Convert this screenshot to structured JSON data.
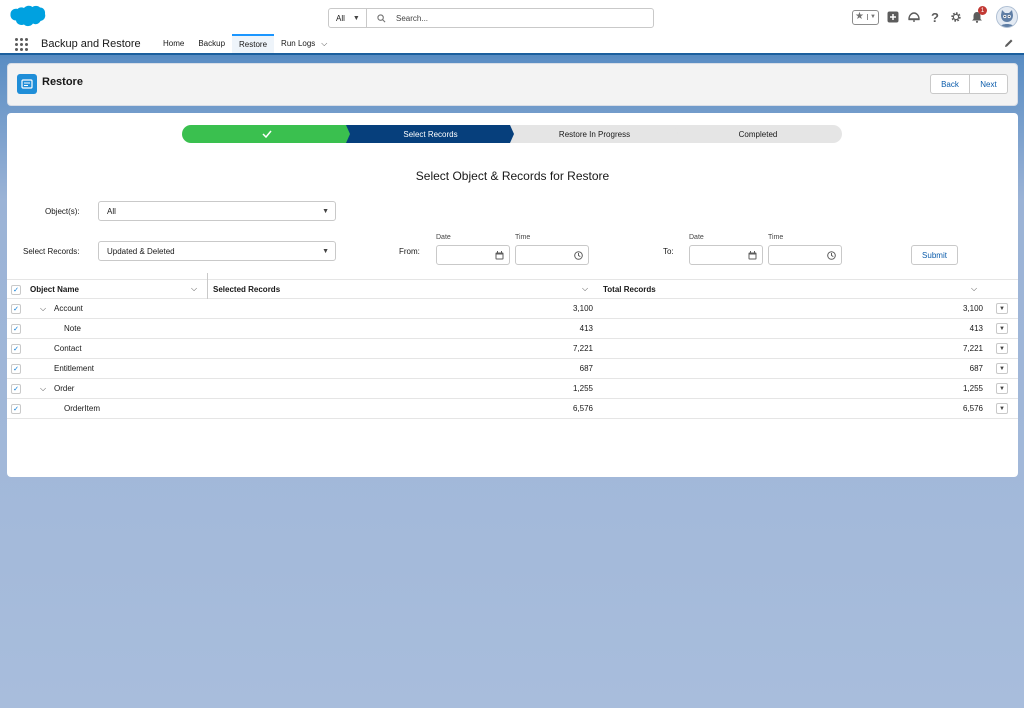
{
  "search": {
    "scope": "All",
    "placeholder": "Search..."
  },
  "header": {
    "notification_count": "1"
  },
  "app": {
    "name": "Backup and Restore",
    "tabs": [
      {
        "label": "Home"
      },
      {
        "label": "Backup"
      },
      {
        "label": "Restore"
      },
      {
        "label": "Run Logs"
      }
    ]
  },
  "page": {
    "title": "Restore",
    "back_label": "Back",
    "next_label": "Next"
  },
  "path": {
    "steps": [
      {
        "label": "",
        "status": "complete"
      },
      {
        "label": "Select Records",
        "status": "current"
      },
      {
        "label": "Restore In Progress",
        "status": "incomplete"
      },
      {
        "label": "Completed",
        "status": "incomplete"
      }
    ]
  },
  "form": {
    "title": "Select Object & Records for Restore",
    "objects_label": "Object(s):",
    "objects_value": "All",
    "records_label": "Select Records:",
    "records_value": "Updated & Deleted",
    "from_label": "From:",
    "to_label": "To:",
    "date_label": "Date",
    "time_label": "Time",
    "submit_label": "Submit"
  },
  "table": {
    "columns": [
      "Object Name",
      "Selected Records",
      "Total Records"
    ],
    "rows": [
      {
        "name": "Account",
        "selected": "3,100",
        "total": "3,100",
        "level": 1,
        "expandable": true
      },
      {
        "name": "Note",
        "selected": "413",
        "total": "413",
        "level": 2,
        "expandable": false
      },
      {
        "name": "Contact",
        "selected": "7,221",
        "total": "7,221",
        "level": 1,
        "expandable": false
      },
      {
        "name": "Entitlement",
        "selected": "687",
        "total": "687",
        "level": 1,
        "expandable": false
      },
      {
        "name": "Order",
        "selected": "1,255",
        "total": "1,255",
        "level": 1,
        "expandable": true
      },
      {
        "name": "OrderItem",
        "selected": "6,576",
        "total": "6,576",
        "level": 2,
        "expandable": false
      }
    ]
  },
  "colors": {
    "brand": "#1b96ff",
    "path_complete": "#3ac04f",
    "path_current": "#063f7c",
    "link": "#0b5cab",
    "notification": "#c23934"
  }
}
